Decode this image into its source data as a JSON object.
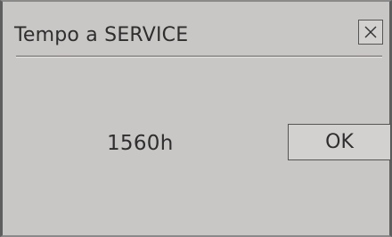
{
  "dialog": {
    "title": "Tempo a SERVICE",
    "close_icon": "close-icon",
    "service_time": "1560h",
    "ok_label": "OK"
  },
  "colors": {
    "dialog_background": "#c9c6c6",
    "text": "#2e2e2e",
    "button_border": "#555555"
  }
}
